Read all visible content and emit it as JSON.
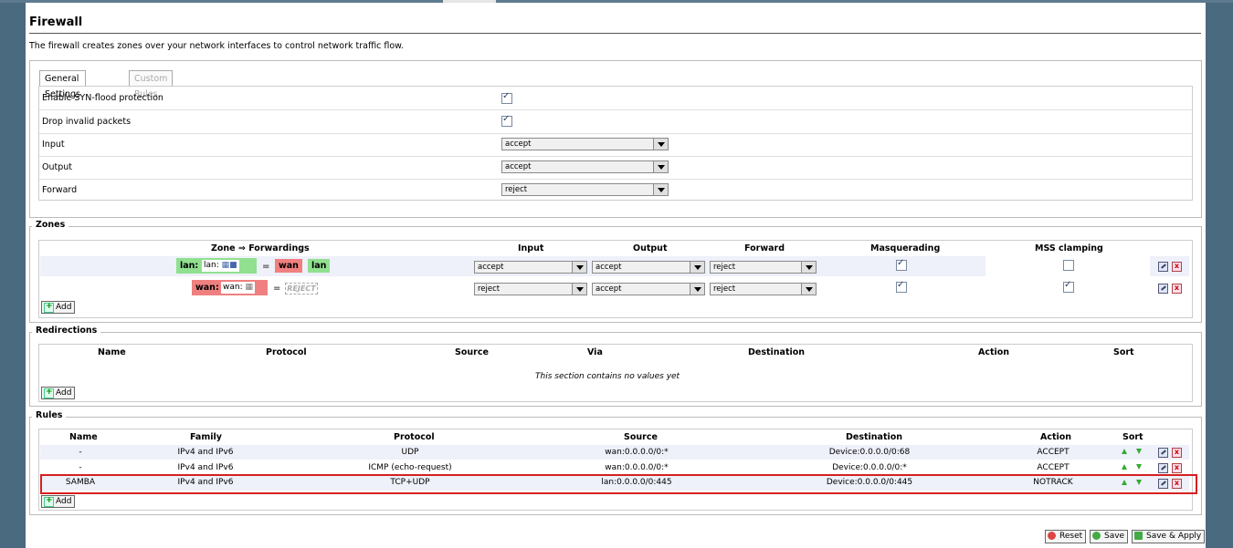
{
  "page": {
    "title": "Firewall",
    "description": "The firewall creates zones over your network interfaces to control network traffic flow."
  },
  "tabs": [
    {
      "label": "General Settings",
      "active": true
    },
    {
      "label": "Custom Rules",
      "active": false
    }
  ],
  "general": {
    "syn_flood_label": "Enable SYN-flood protection",
    "syn_flood_checked": true,
    "drop_invalid_label": "Drop invalid packets",
    "drop_invalid_checked": true,
    "input_label": "Input",
    "input_value": "accept",
    "output_label": "Output",
    "output_value": "accept",
    "forward_label": "Forward",
    "forward_value": "reject"
  },
  "zones": {
    "legend": "Zones",
    "headers": {
      "zone": "Zone ⇒ Forwardings",
      "input": "Input",
      "output": "Output",
      "forward": "Forward",
      "masq": "Masquerading",
      "mss": "MSS clamping"
    },
    "rows": [
      {
        "name": "lan:",
        "sub": "lan:",
        "eq": "=",
        "fwd1": "wan",
        "fwd2": "lan",
        "input": "accept",
        "output": "accept",
        "forward": "reject",
        "masq": true,
        "mss": false
      },
      {
        "name": "wan:",
        "sub": "wan:",
        "eq": "=",
        "fwd1": "REJECT",
        "input": "reject",
        "output": "accept",
        "forward": "reject",
        "masq": true,
        "mss": true
      }
    ],
    "add_label": "Add"
  },
  "redirections": {
    "legend": "Redirections",
    "headers": {
      "name": "Name",
      "protocol": "Protocol",
      "source": "Source",
      "via": "Via",
      "destination": "Destination",
      "action": "Action",
      "sort": "Sort"
    },
    "empty": "This section contains no values yet",
    "add_label": "Add"
  },
  "rules": {
    "legend": "Rules",
    "headers": {
      "name": "Name",
      "family": "Family",
      "protocol": "Protocol",
      "source": "Source",
      "destination": "Destination",
      "action": "Action",
      "sort": "Sort"
    },
    "rows": [
      {
        "name": "-",
        "family": "IPv4 and IPv6",
        "protocol": "UDP",
        "source": "wan:0.0.0.0/0:*",
        "destination": "Device:0.0.0.0/0:68",
        "action": "ACCEPT"
      },
      {
        "name": "-",
        "family": "IPv4 and IPv6",
        "protocol": "ICMP (echo-request)",
        "source": "wan:0.0.0.0/0:*",
        "destination": "Device:0.0.0.0/0:*",
        "action": "ACCEPT"
      },
      {
        "name": "SAMBA",
        "family": "IPv4 and IPv6",
        "protocol": "TCP+UDP",
        "source": "lan:0.0.0.0/0:445",
        "destination": "Device:0.0.0.0/0:445",
        "action": "NOTRACK"
      }
    ],
    "add_label": "Add"
  },
  "buttons": {
    "reset": "Reset",
    "save": "Save",
    "save_apply": "Save & Apply"
  },
  "colors": {
    "lan_zone": "#90e090",
    "wan_zone": "#f08080",
    "highlight": "#d62020"
  }
}
